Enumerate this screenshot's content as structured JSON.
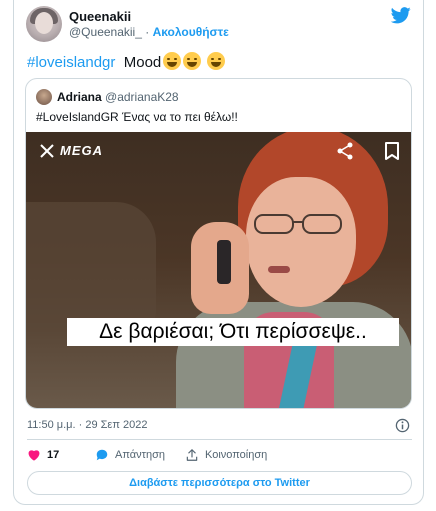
{
  "tweet": {
    "author_name": "Queenakii",
    "author_handle": "@Queenakii_",
    "separator": "·",
    "follow_label": "Ακολουθήστε",
    "hashtag": "#loveislandgr",
    "text": "Mood",
    "timestamp": "11:50 μ.μ. · 29 Σεπ 2022"
  },
  "quoted": {
    "author_name": "Adriana",
    "author_handle": "@adrianaK28",
    "text": "#LoveIslandGR  Ένας να το πει θέλω!!",
    "media": {
      "channel_logo": "MEGA",
      "caption": "Δε βαριέσαι; Ότι περίσσεψε.."
    }
  },
  "actions": {
    "like_count": "17",
    "reply_label": "Απάντηση",
    "share_label": "Κοινοποίηση"
  },
  "read_more_label": "Διαβάστε περισσότερα στο Twitter",
  "colors": {
    "accent": "#1d9bf0",
    "heart": "#f91880",
    "text": "#0f1419",
    "muted": "#536471",
    "border": "#cfd9de"
  },
  "icons": [
    "twitter-bird-icon",
    "close-icon",
    "share-icon",
    "bookmark-icon",
    "info-icon",
    "heart-icon",
    "reply-icon",
    "share-arrow-icon",
    "laughing-emoji-icon"
  ]
}
